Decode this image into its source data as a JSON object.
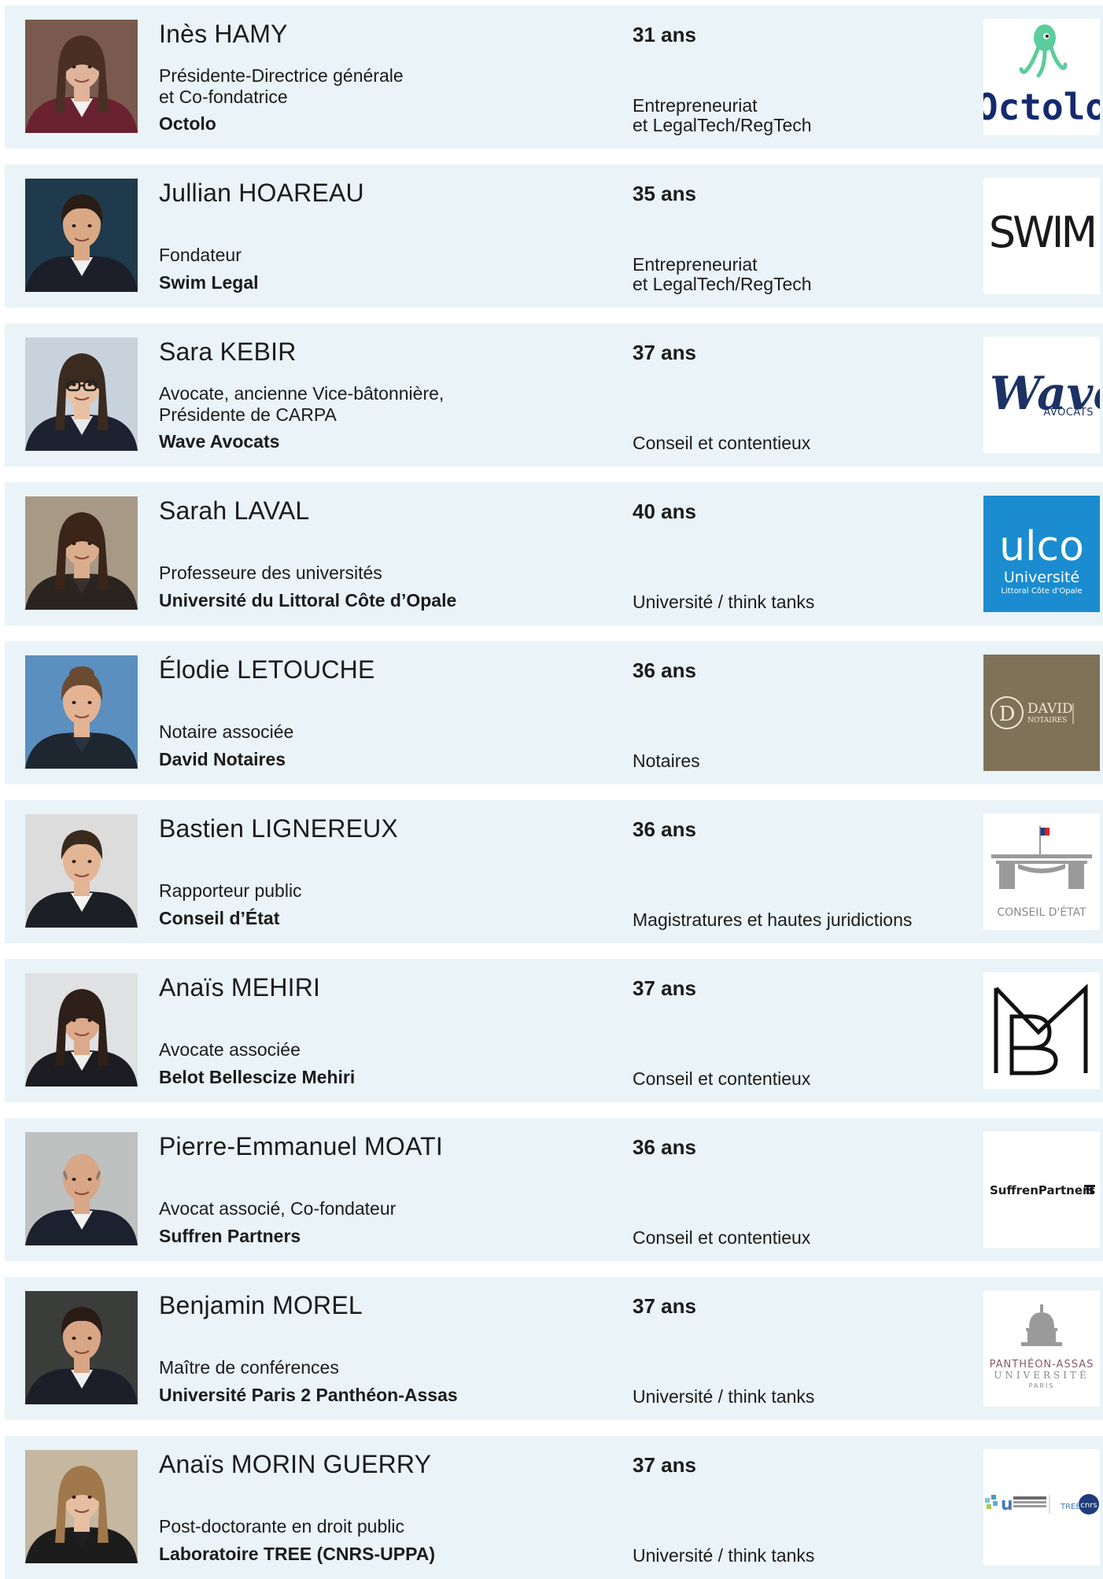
{
  "people": [
    {
      "name": "Inès HAMY",
      "role_lines": [
        "Présidente-Directrice générale",
        "et Co-fondatrice"
      ],
      "organization": "Octolo",
      "age": "31 ans",
      "domain_lines": [
        "Entrepreneuriat",
        "et LegalTech/RegTech"
      ],
      "logo_text": "Octolo",
      "logo_icon": "octopus-icon"
    },
    {
      "name": "Jullian HOAREAU",
      "role_lines": [
        "Fondateur"
      ],
      "organization": "Swim Legal",
      "age": "35 ans",
      "domain_lines": [
        "Entrepreneuriat",
        "et LegalTech/RegTech"
      ],
      "logo_text": "SWIM"
    },
    {
      "name": "Sara KEBIR",
      "role_lines": [
        "Avocate, ancienne Vice-bâtonnière,",
        "Présidente de CARPA"
      ],
      "organization": "Wave Avocats",
      "age": "37 ans",
      "domain_lines": [
        "Conseil et contentieux"
      ],
      "logo_text": "Wave",
      "logo_subtext": "AVOCATS"
    },
    {
      "name": "Sarah LAVAL",
      "role_lines": [
        "Professeure des universités"
      ],
      "organization": "Université du Littoral Côte d’Opale",
      "age": "40 ans",
      "domain_lines": [
        "Université / think tanks"
      ],
      "logo_text": "ulco",
      "logo_subtext": "Université",
      "logo_subtext2": "Littoral Côte d'Opale",
      "logo_bg": "#1a8ccf"
    },
    {
      "name": "Élodie LETOUCHE",
      "role_lines": [
        "Notaire associée"
      ],
      "organization": "David Notaires",
      "age": "36 ans",
      "domain_lines": [
        "Notaires"
      ],
      "logo_text": "DAVID",
      "logo_subtext": "NOTAIRES",
      "logo_initial": "D",
      "logo_bg": "#7f7259"
    },
    {
      "name": "Bastien LIGNEREUX",
      "role_lines": [
        "Rapporteur public"
      ],
      "organization": "Conseil d’État",
      "age": "36 ans",
      "domain_lines": [
        "Magistratures et hautes juridictions"
      ],
      "logo_text": "CONSEIL D'ÉTAT",
      "logo_icon": "building-icon"
    },
    {
      "name": "Anaïs MEHIRI",
      "role_lines": [
        "Avocate associée"
      ],
      "organization": "Belot Bellescize Mehiri",
      "age": "37 ans",
      "domain_lines": [
        "Conseil et contentieux"
      ],
      "logo_icon": "monogram-icon"
    },
    {
      "name": "Pierre-Emmanuel MOATI",
      "role_lines": [
        "Avocat associé, Co-fondateur"
      ],
      "organization": "Suffren Partners",
      "age": "36 ans",
      "domain_lines": [
        "Conseil et contentieux"
      ],
      "logo_text": "SuffrenPartners"
    },
    {
      "name": "Benjamin MOREL",
      "role_lines": [
        "Maître de conférences"
      ],
      "organization": "Université Paris 2 Panthéon-Assas",
      "age": "37 ans",
      "domain_lines": [
        "Université / think tanks"
      ],
      "logo_text": "PANTHÉON-ASSAS",
      "logo_subtext": "UNIVERSITÉ",
      "logo_subtext2": "PARIS",
      "logo_icon": "dome-icon"
    },
    {
      "name": "Anaïs MORIN GUERRY",
      "role_lines": [
        "Post-doctorante en droit public"
      ],
      "organization": "Laboratoire TREE (CNRS-UPPA)",
      "age": "37 ans",
      "domain_lines": [
        "Université / think tanks"
      ],
      "logo_text": "TREE",
      "logo_subtext": "cnrs",
      "logo_icon": "university-logos-icon"
    }
  ],
  "colors": {
    "card_bg": "#eaf4f8",
    "text": "#1b1b1b",
    "octolo_green": "#5ccc9c",
    "octolo_navy": "#142a6e"
  }
}
